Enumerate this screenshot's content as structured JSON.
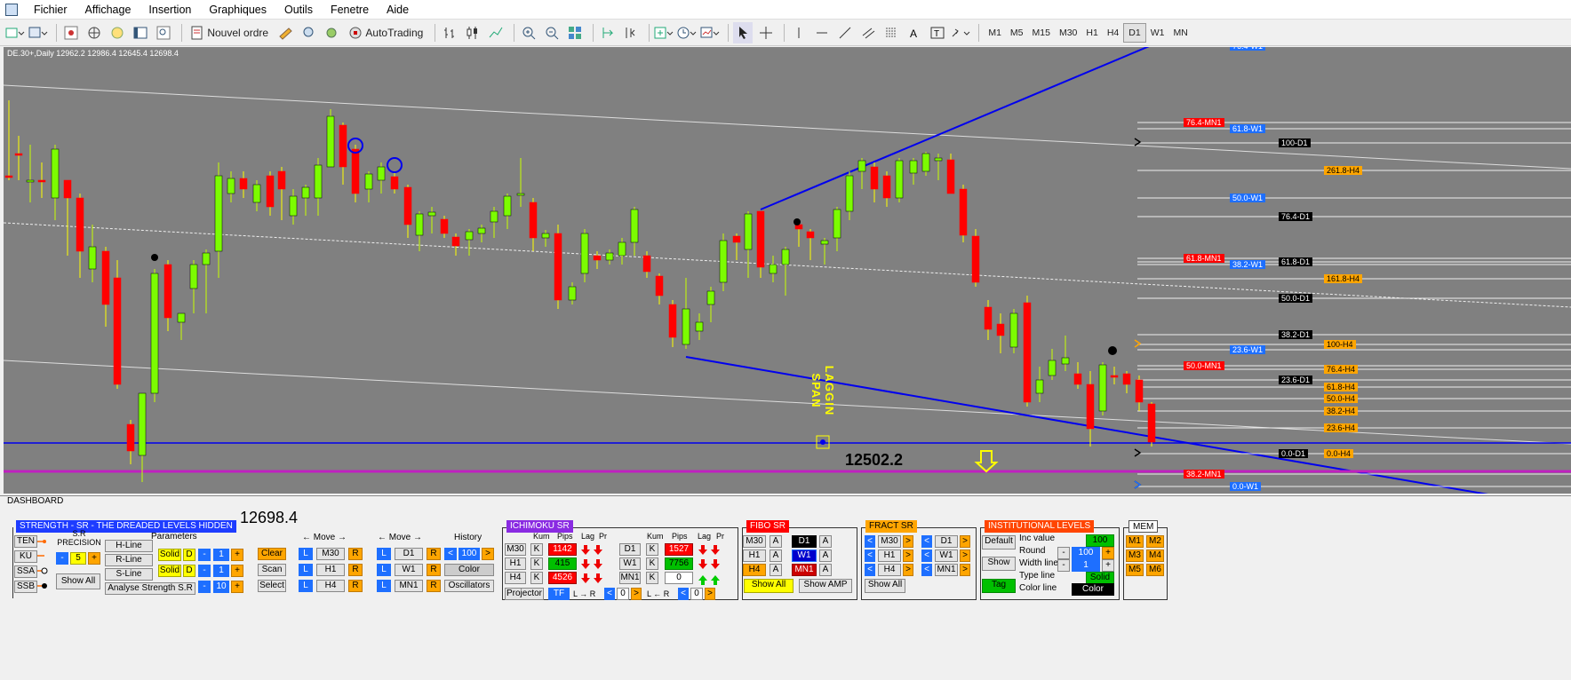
{
  "menu": [
    "Fichier",
    "Affichage",
    "Insertion",
    "Graphiques",
    "Outils",
    "Fenetre",
    "Aide"
  ],
  "toolbar": {
    "new_order": "Nouvel ordre",
    "autotrading": "AutoTrading",
    "timeframes": [
      "M1",
      "M5",
      "M15",
      "M30",
      "H1",
      "H4",
      "D1",
      "W1",
      "MN"
    ],
    "active_timeframe": "D1"
  },
  "chart": {
    "header": "DE.30+,Daily  12962.2 12986.4 12645.4 12698.4",
    "laggin_span": "LAGGIN SPAN",
    "level_price": "12502.2",
    "right_labels": [
      {
        "t": "76.4-W1",
        "c": "#1e6fff",
        "fg": "#fff"
      },
      {
        "t": "76.4-MN1",
        "c": "#ff0000",
        "fg": "#fff"
      },
      {
        "t": "61.8-W1",
        "c": "#1e6fff",
        "fg": "#fff"
      },
      {
        "t": "100-D1",
        "c": "#000",
        "fg": "#fff"
      },
      {
        "t": "261.8-H4",
        "c": "#ffa500",
        "fg": "#000"
      },
      {
        "t": "50.0-W1",
        "c": "#1e6fff",
        "fg": "#fff"
      },
      {
        "t": "76.4-D1",
        "c": "#000",
        "fg": "#fff"
      },
      {
        "t": "61.8-MN1",
        "c": "#ff0000",
        "fg": "#fff"
      },
      {
        "t": "38.2-W1",
        "c": "#1e6fff",
        "fg": "#fff"
      },
      {
        "t": "61.8-D1",
        "c": "#000",
        "fg": "#fff"
      },
      {
        "t": "161.8-H4",
        "c": "#ffa500",
        "fg": "#000"
      },
      {
        "t": "50.0-D1",
        "c": "#000",
        "fg": "#fff"
      },
      {
        "t": "38.2-D1",
        "c": "#000",
        "fg": "#fff"
      },
      {
        "t": "23.6-W1",
        "c": "#1e6fff",
        "fg": "#fff"
      },
      {
        "t": "100-H4",
        "c": "#ffa500",
        "fg": "#000"
      },
      {
        "t": "50.0-MN1",
        "c": "#ff0000",
        "fg": "#fff"
      },
      {
        "t": "76.4-H4",
        "c": "#ffa500",
        "fg": "#000"
      },
      {
        "t": "23.6-D1",
        "c": "#000",
        "fg": "#fff"
      },
      {
        "t": "61.8-H4",
        "c": "#ffa500",
        "fg": "#000"
      },
      {
        "t": "50.0-H4",
        "c": "#ffa500",
        "fg": "#000"
      },
      {
        "t": "38.2-H4",
        "c": "#ffa500",
        "fg": "#000"
      },
      {
        "t": "23.6-H4",
        "c": "#ffa500",
        "fg": "#000"
      },
      {
        "t": "0.0-D1",
        "c": "#000",
        "fg": "#fff"
      },
      {
        "t": "0.0-H4",
        "c": "#ffa500",
        "fg": "#000"
      },
      {
        "t": "38.2-MN1",
        "c": "#ff0000",
        "fg": "#fff"
      },
      {
        "t": "0.0-W1",
        "c": "#1e6fff",
        "fg": "#fff"
      }
    ]
  },
  "dashboard": {
    "label": "DASHBOARD",
    "price": "12698.4",
    "strength": {
      "title": "STRENGTH - SR - THE DREADED LEVELS HIDDEN",
      "ten": "TEN",
      "ku": "KU",
      "ssa": "SSA",
      "ssb": "SSB",
      "sr_precision": "S.R PRECISION",
      "minus": "-",
      "plus": "+",
      "precision_value": "5",
      "show_all": "Show All",
      "parameters": "Parameters",
      "h_line": "H-Line",
      "r_line": "R-Line",
      "s_line": "S-Line",
      "analyse": "Analyse Strength S.R",
      "solid": "Solid",
      "d": "D",
      "one": "1",
      "ten_val": "10",
      "clear": "Clear",
      "scan": "Scan",
      "select": "Select",
      "move": "Move",
      "history": "History",
      "l": "L",
      "r": "R",
      "m30": "M30",
      "h1": "H1",
      "h4": "H4",
      "d1": "D1",
      "w1": "W1",
      "mn1": "MN1",
      "history_value": "100",
      "lt": "<",
      "gt": ">",
      "color": "Color",
      "oscillators": "Oscillators"
    },
    "ichimoku": {
      "title": "ICHIMOKU SR",
      "kum": "Kum",
      "pips": "Pips",
      "lag": "Lag",
      "pr": "Pr",
      "k": "K",
      "rows_left": [
        {
          "tf": "M30",
          "pips": "1142",
          "c": "rd"
        },
        {
          "tf": "H1",
          "pips": "415",
          "c": "gn"
        },
        {
          "tf": "H4",
          "pips": "4526",
          "c": "rd"
        }
      ],
      "rows_right": [
        {
          "tf": "D1",
          "pips": "1527",
          "c": "rd"
        },
        {
          "tf": "W1",
          "pips": "7756",
          "c": "gn"
        },
        {
          "tf": "MN1",
          "pips": "0",
          "c": "wh"
        }
      ],
      "projector": "Projector",
      "tf": "TF",
      "lr": "L",
      "r": "R",
      "zero": "0"
    },
    "fibo": {
      "title": "FIBO SR",
      "m30": "M30",
      "h1": "H1",
      "h4": "H4",
      "d1": "D1",
      "w1": "W1",
      "mn1": "MN1",
      "a": "A",
      "show_all": "Show All",
      "show_amp": "Show AMP"
    },
    "fract": {
      "title": "FRACT SR",
      "m30": "M30",
      "h1": "H1",
      "h4": "H4",
      "d1": "D1",
      "w1": "W1",
      "mn1": "MN1",
      "lt": "<",
      "gt": ">",
      "show_all": "Show All"
    },
    "institutional": {
      "title": "INSTITUTIONAL LEVELS",
      "default": "Default",
      "show": "Show",
      "tag": "Tag",
      "inc_value": "Inc value",
      "inc": "100",
      "round": "Round",
      "round_value": "100",
      "width_line": "Width line",
      "width": "1",
      "type_line": "Type line",
      "type": "Solid",
      "color_line": "Color line",
      "color": "Color",
      "minus": "-",
      "plus": "+"
    },
    "mem": {
      "title": "MEM",
      "items": [
        "M1",
        "M2",
        "M3",
        "M4",
        "M5",
        "M6"
      ]
    }
  }
}
